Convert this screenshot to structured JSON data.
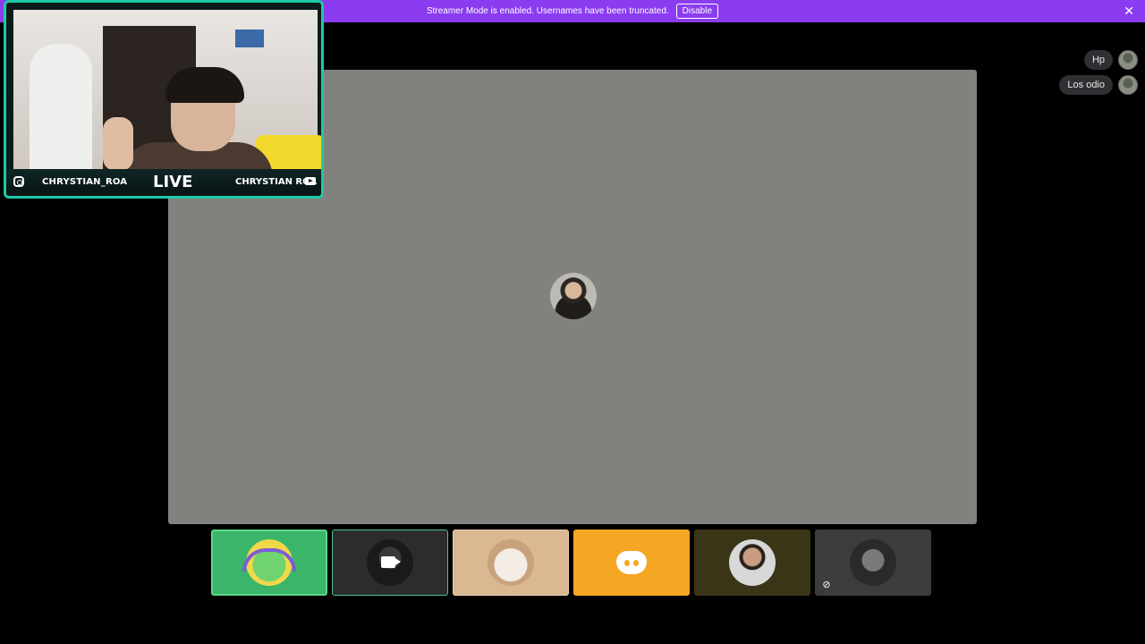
{
  "banner": {
    "message": "Streamer Mode is enabled. Usernames have been truncated.",
    "disable_label": "Disable",
    "close_glyph": "✕",
    "color": "#8b3cf0"
  },
  "webcam": {
    "left_name": "CHRYSTIAN_ROA",
    "live_label": "LIVE",
    "right_name": "CHRYSTIAN ROA",
    "frame_color": "#1ec9a6",
    "icons": [
      "instagram-icon",
      "youtube-icon"
    ]
  },
  "chat": {
    "messages": [
      {
        "text": "Hp"
      },
      {
        "text": "Los odio"
      }
    ]
  },
  "stage": {
    "background": "#81817d"
  },
  "participants": [
    {
      "id": "p1",
      "kind": "avatar",
      "color": "#3ab56a"
    },
    {
      "id": "p2",
      "kind": "camera-off",
      "color": "#2c2c2c"
    },
    {
      "id": "p3",
      "kind": "avatar",
      "color": "#d9b892"
    },
    {
      "id": "p4",
      "kind": "discord-default",
      "color": "#f5a623"
    },
    {
      "id": "p5",
      "kind": "avatar",
      "color": "#3b3517"
    },
    {
      "id": "p6",
      "kind": "avatar-muted",
      "color": "#3b3c3d"
    }
  ],
  "icons": {
    "mute_glyph": "🎙"
  }
}
